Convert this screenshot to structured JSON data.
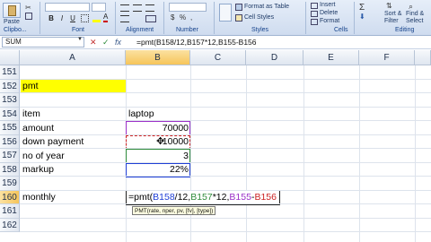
{
  "ribbon": {
    "clipboard": {
      "paste_label": "Paste",
      "group_label": "Clipbo..."
    },
    "font": {
      "bold": "B",
      "italic": "I",
      "underline": "U",
      "group_label": "Font"
    },
    "alignment": {
      "group_label": "Alignment"
    },
    "number": {
      "group_label": "Number"
    },
    "styles": {
      "format_as_table": "Format as Table",
      "cell_styles": "Cell Styles",
      "group_label": "Styles"
    },
    "cells": {
      "insert": "Insert",
      "delete": "Delete",
      "format": "Format",
      "group_label": "Cells"
    },
    "editing": {
      "sort_filter": "Sort &",
      "filter": "Filter",
      "find_select": "Find &",
      "select": "Select",
      "group_label": "Editing"
    }
  },
  "formula_bar": {
    "name_box": "SUM",
    "cancel_icon": "✕",
    "enter_icon": "✓",
    "fx_label": "fx",
    "formula": "=pmt(B158/12,B157*12,B155-B156"
  },
  "columns": [
    "A",
    "B",
    "C",
    "D",
    "E",
    "F"
  ],
  "active_column": "B",
  "rows": [
    {
      "num": "151",
      "a": "",
      "b": ""
    },
    {
      "num": "152",
      "a": "pmt",
      "b": ""
    },
    {
      "num": "153",
      "a": "",
      "b": ""
    },
    {
      "num": "154",
      "a": "item",
      "b": "laptop"
    },
    {
      "num": "155",
      "a": "amount",
      "b": "70000"
    },
    {
      "num": "156",
      "a": "down payment",
      "b": "10000"
    },
    {
      "num": "157",
      "a": "no of year",
      "b": "3"
    },
    {
      "num": "158",
      "a": "markup",
      "b": "22%"
    },
    {
      "num": "159",
      "a": "",
      "b": ""
    },
    {
      "num": "160",
      "a": "monthly",
      "b": ""
    },
    {
      "num": "161",
      "a": "",
      "b": ""
    },
    {
      "num": "162",
      "a": "",
      "b": ""
    }
  ],
  "active_row": "160",
  "edit_cell": {
    "prefix": "=pmt(",
    "ref1": "B158",
    "sep1": "/12,",
    "ref2": "B157",
    "sep2": "*12,",
    "ref3": "B155",
    "sep3": "-",
    "ref4": "B156"
  },
  "tooltip": "PMT(rate, nper, pv, [fv], [type])",
  "colors": {
    "highlight_yellow": "#ffff00",
    "ref_blue": "#1f3fd6",
    "ref_green": "#2e8b3a",
    "ref_purple": "#9b30c8",
    "ref_red": "#cc2222"
  }
}
